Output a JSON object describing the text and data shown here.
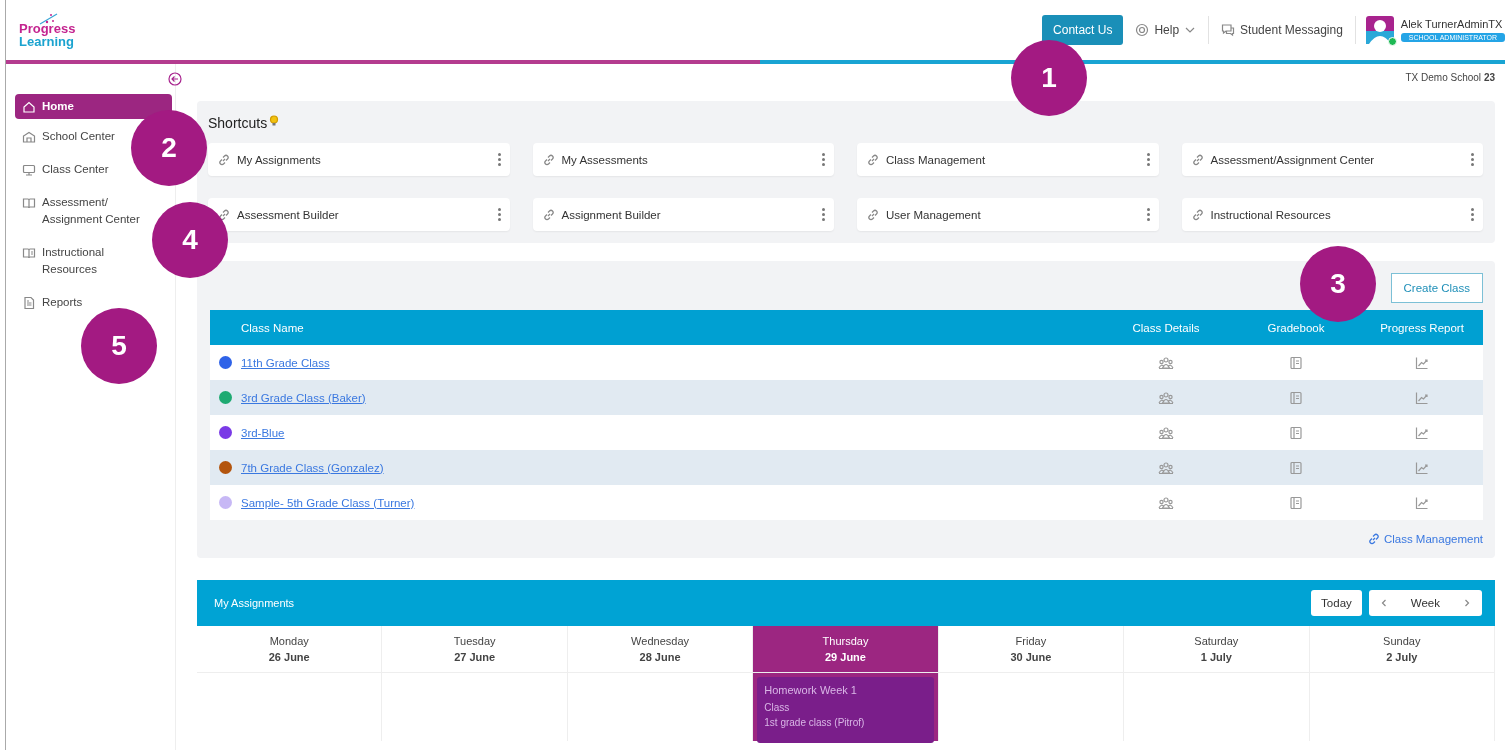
{
  "header": {
    "logo": {
      "line1": "Progress",
      "line2": "Learning"
    },
    "contact_button": "Contact Us",
    "help": "Help",
    "messaging": "Student Messaging",
    "user": {
      "name": "Alek TurnerAdminTX",
      "role": "SCHOOL ADMINISTRATOR"
    }
  },
  "school": "TX Demo School **23**",
  "sidebar": {
    "items": [
      {
        "label": "Home",
        "selected": true
      },
      {
        "label": "School Center",
        "selected": false
      },
      {
        "label": "Class Center",
        "selected": false
      },
      {
        "label": [
          "Assessment/",
          "Assignment Center"
        ],
        "selected": false
      },
      {
        "label": [
          "Instructional",
          "Resources"
        ],
        "selected": false
      },
      {
        "label": "Reports",
        "selected": false
      }
    ]
  },
  "shortcuts": {
    "title": "Shortcuts",
    "items": [
      "My Assignments",
      "My Assessments",
      "Class Management",
      "Assessment/Assignment Center",
      "Assessment Builder",
      "Assignment Builder",
      "User Management",
      "Instructional Resources"
    ]
  },
  "classes": {
    "create_button": "Create Class",
    "columns": [
      "Class Name",
      "Class Details",
      "Gradebook",
      "Progress Report"
    ],
    "rows": [
      {
        "name": "11th Grade Class",
        "color": "#2f63e8"
      },
      {
        "name": "3rd Grade Class (Baker)",
        "color": "#1eaa72"
      },
      {
        "name": "3rd-Blue",
        "color": "#7a3ae6"
      },
      {
        "name": "7th Grade Class (Gonzalez)",
        "color": "#b3550e"
      },
      {
        "name": "Sample- 5th Grade Class (Turner)",
        "color": "#c7b8f5"
      }
    ],
    "footer_link": "Class Management"
  },
  "calendar": {
    "title": "My Assignments",
    "today_button": "Today",
    "view": "Week",
    "days": [
      {
        "weekday": "Monday",
        "date": "26 June",
        "selected": false
      },
      {
        "weekday": "Tuesday",
        "date": "27 June",
        "selected": false
      },
      {
        "weekday": "Wednesday",
        "date": "28 June",
        "selected": false
      },
      {
        "weekday": "Thursday",
        "date": "29 June",
        "selected": true,
        "events": [
          {
            "title": "Homework Week 1",
            "label": "Class",
            "class": "1st grade class (Pitrof)"
          }
        ]
      },
      {
        "weekday": "Friday",
        "date": "30 June",
        "selected": false
      },
      {
        "weekday": "Saturday",
        "date": "1 July",
        "selected": false
      },
      {
        "weekday": "Sunday",
        "date": "2 July",
        "selected": false
      }
    ]
  },
  "callouts": [
    {
      "number": "1"
    },
    {
      "number": "2"
    },
    {
      "number": "4"
    },
    {
      "number": "3"
    },
    {
      "number": "5"
    }
  ]
}
